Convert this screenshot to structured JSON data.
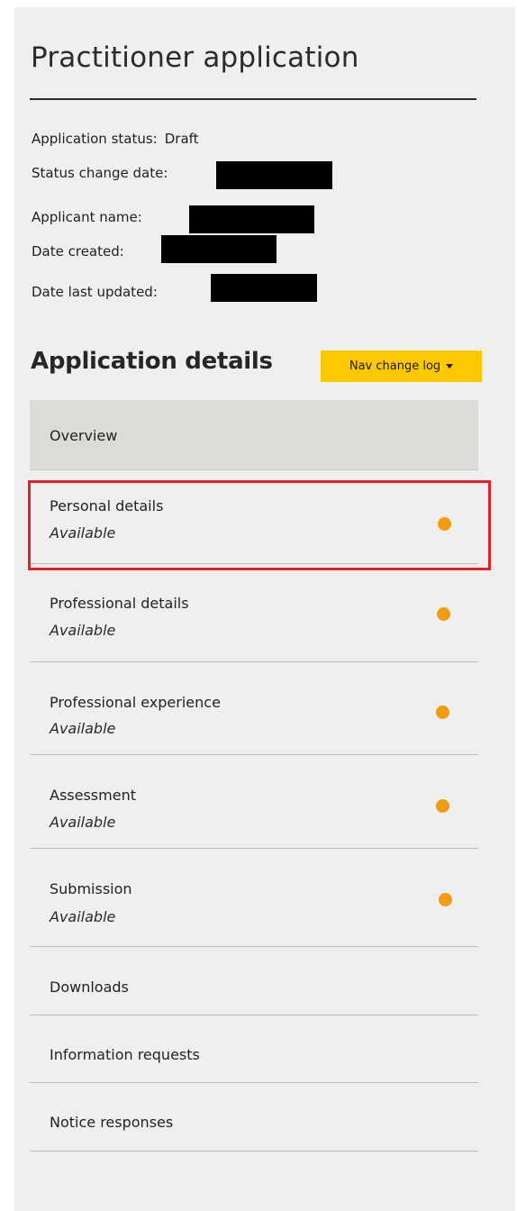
{
  "page": {
    "title": "Practitioner application"
  },
  "meta": {
    "status_label": "Application status:",
    "status_value": "Draft",
    "status_change_label": "Status change date:",
    "applicant_label": "Applicant name:",
    "created_label": "Date created:",
    "updated_label": "Date last updated:"
  },
  "section": {
    "title": "Application details",
    "nav_change_log_label": "Nav change log"
  },
  "nav": {
    "overview": "Overview",
    "items": [
      {
        "label": "Personal details",
        "status": "Available"
      },
      {
        "label": "Professional details",
        "status": "Available"
      },
      {
        "label": "Professional experience",
        "status": "Available"
      },
      {
        "label": "Assessment",
        "status": "Available"
      },
      {
        "label": "Submission",
        "status": "Available"
      }
    ],
    "downloads": "Downloads",
    "information_requests": "Information requests",
    "notice_responses": "Notice responses"
  },
  "colors": {
    "status_dot": "#f39c12",
    "accent_button": "#fcc800",
    "highlight": "#e32027"
  }
}
